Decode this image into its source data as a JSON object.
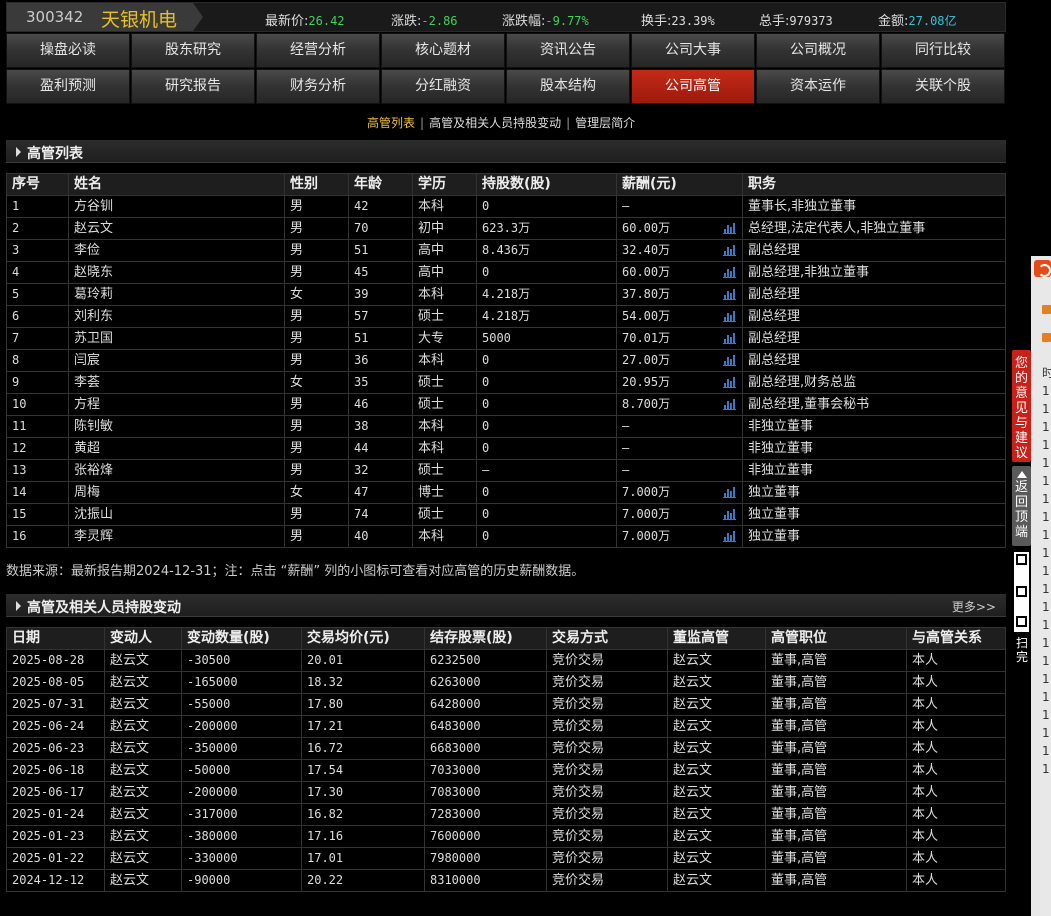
{
  "quote": {
    "code": "300342",
    "name": "天银机电",
    "fields": [
      {
        "label": "最新价:",
        "value": "26.42",
        "color": "#3dd35a"
      },
      {
        "label": "涨跌:",
        "value": "-2.86",
        "color": "#3dd35a"
      },
      {
        "label": "涨跌幅:",
        "value": "-9.77%",
        "color": "#3dd35a"
      },
      {
        "label": "换手:",
        "value": "23.39%",
        "color": "#dddddd"
      },
      {
        "label": "总手:",
        "value": "979373",
        "color": "#dddddd"
      },
      {
        "label": "金额:",
        "value": "27.08亿",
        "color": "#33c3d8"
      }
    ]
  },
  "nav": {
    "row1": [
      "操盘必读",
      "股东研究",
      "经营分析",
      "核心题材",
      "资讯公告",
      "公司大事",
      "公司概况",
      "同行比较"
    ],
    "row2": [
      "盈利预测",
      "研究报告",
      "财务分析",
      "分红融资",
      "股本结构",
      "公司高管",
      "资本运作",
      "关联个股"
    ],
    "active": "公司高管",
    "active_color": "#c42a18"
  },
  "subtabs": [
    "高管列表",
    "高管及相关人员持股变动",
    "管理层简介"
  ],
  "exec": {
    "title": "高管列表",
    "headers": [
      "序号",
      "姓名",
      "性别",
      "年龄",
      "学历",
      "持股数(股)",
      "薪酬(元)",
      "职务"
    ],
    "rows": [
      [
        "1",
        "方谷钏",
        "男",
        "42",
        "本科",
        "0",
        "—",
        "董事长,非独立董事"
      ],
      [
        "2",
        "赵云文",
        "男",
        "70",
        "初中",
        "623.3万",
        "60.00万",
        "总经理,法定代表人,非独立董事"
      ],
      [
        "3",
        "李俭",
        "男",
        "51",
        "高中",
        "8.436万",
        "32.40万",
        "副总经理"
      ],
      [
        "4",
        "赵晓东",
        "男",
        "45",
        "高中",
        "0",
        "60.00万",
        "副总经理,非独立董事"
      ],
      [
        "5",
        "葛玲莉",
        "女",
        "39",
        "本科",
        "4.218万",
        "37.80万",
        "副总经理"
      ],
      [
        "6",
        "刘利东",
        "男",
        "57",
        "硕士",
        "4.218万",
        "54.00万",
        "副总经理"
      ],
      [
        "7",
        "苏卫国",
        "男",
        "51",
        "大专",
        "5000",
        "70.01万",
        "副总经理"
      ],
      [
        "8",
        "闫宸",
        "男",
        "36",
        "本科",
        "0",
        "27.00万",
        "副总经理"
      ],
      [
        "9",
        "李荟",
        "女",
        "35",
        "硕士",
        "0",
        "20.95万",
        "副总经理,财务总监"
      ],
      [
        "10",
        "方程",
        "男",
        "46",
        "硕士",
        "0",
        "8.700万",
        "副总经理,董事会秘书"
      ],
      [
        "11",
        "陈钊敏",
        "男",
        "38",
        "本科",
        "0",
        "—",
        "非独立董事"
      ],
      [
        "12",
        "黄超",
        "男",
        "44",
        "本科",
        "0",
        "—",
        "非独立董事"
      ],
      [
        "13",
        "张裕烽",
        "男",
        "32",
        "硕士",
        "—",
        "—",
        "非独立董事"
      ],
      [
        "14",
        "周梅",
        "女",
        "47",
        "博士",
        "0",
        "7.000万",
        "独立董事"
      ],
      [
        "15",
        "沈振山",
        "男",
        "74",
        "硕士",
        "0",
        "7.000万",
        "独立董事"
      ],
      [
        "16",
        "李灵辉",
        "男",
        "40",
        "本科",
        "0",
        "7.000万",
        "独立董事"
      ]
    ],
    "salary_icon": "bar-chart-icon"
  },
  "source_note": "数据来源：最新报告期2024-12-31；注：点击 “薪酬” 列的小图标可查看对应高管的历史薪酬数据。",
  "holdings": {
    "title": "高管及相关人员持股变动",
    "more": "更多>>",
    "headers": [
      "日期",
      "变动人",
      "变动数量(股)",
      "交易均价(元)",
      "结存股票(股)",
      "交易方式",
      "董监高管",
      "高管职位",
      "与高管关系"
    ],
    "rows": [
      [
        "2025-08-28",
        "赵云文",
        "-30500",
        "20.01",
        "6232500",
        "竞价交易",
        "赵云文",
        "董事,高管",
        "本人"
      ],
      [
        "2025-08-05",
        "赵云文",
        "-165000",
        "18.32",
        "6263000",
        "竞价交易",
        "赵云文",
        "董事,高管",
        "本人"
      ],
      [
        "2025-07-31",
        "赵云文",
        "-55000",
        "17.80",
        "6428000",
        "竞价交易",
        "赵云文",
        "董事,高管",
        "本人"
      ],
      [
        "2025-06-24",
        "赵云文",
        "-200000",
        "17.21",
        "6483000",
        "竞价交易",
        "赵云文",
        "董事,高管",
        "本人"
      ],
      [
        "2025-06-23",
        "赵云文",
        "-350000",
        "16.72",
        "6683000",
        "竞价交易",
        "赵云文",
        "董事,高管",
        "本人"
      ],
      [
        "2025-06-18",
        "赵云文",
        "-50000",
        "17.54",
        "7033000",
        "竞价交易",
        "赵云文",
        "董事,高管",
        "本人"
      ],
      [
        "2025-06-17",
        "赵云文",
        "-200000",
        "17.30",
        "7083000",
        "竞价交易",
        "赵云文",
        "董事,高管",
        "本人"
      ],
      [
        "2025-01-24",
        "赵云文",
        "-317000",
        "16.82",
        "7283000",
        "竞价交易",
        "赵云文",
        "董事,高管",
        "本人"
      ],
      [
        "2025-01-23",
        "赵云文",
        "-380000",
        "17.16",
        "7600000",
        "竞价交易",
        "赵云文",
        "董事,高管",
        "本人"
      ],
      [
        "2025-01-22",
        "赵云文",
        "-330000",
        "17.01",
        "7980000",
        "竞价交易",
        "赵云文",
        "董事,高管",
        "本人"
      ],
      [
        "2024-12-12",
        "赵云文",
        "-90000",
        "20.22",
        "8310000",
        "竞价交易",
        "赵云文",
        "董事,高管",
        "本人"
      ]
    ]
  },
  "side": {
    "feedback": "您的意见与建议",
    "back_top": "返回顶端",
    "scan": "扫完",
    "logo_icon": "feedback-logo-icon",
    "panel_col": [
      "时",
      "1",
      "1",
      "1",
      "1",
      "1",
      "1",
      "1",
      "1",
      "1",
      "1",
      "1",
      "1",
      "1",
      "1",
      "1",
      "1",
      "1",
      "1",
      "1",
      "1",
      "1",
      "1"
    ]
  }
}
